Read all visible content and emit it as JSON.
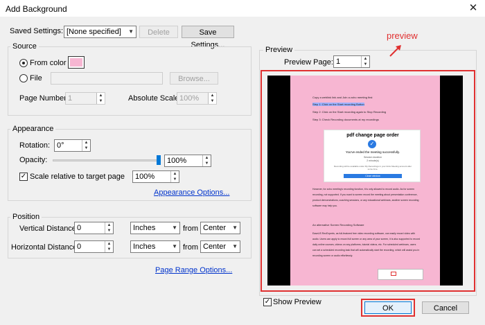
{
  "window": {
    "title": "Add Background",
    "close_icon": "close-icon"
  },
  "saved_settings": {
    "label": "Saved Settings:",
    "value": "[None specified]",
    "delete_label": "Delete",
    "save_label": "Save Settings..."
  },
  "source": {
    "heading": "Source",
    "from_color_label": "From color",
    "color_swatch": "#f7b6d2",
    "file_label": "File",
    "browse_label": "Browse...",
    "page_number_label": "Page Number:",
    "page_number_value": "1",
    "absolute_scale_label": "Absolute Scale:",
    "absolute_scale_value": "100%"
  },
  "appearance": {
    "heading": "Appearance",
    "rotation_label": "Rotation:",
    "rotation_value": "0°",
    "opacity_label": "Opacity:",
    "opacity_value": "100%",
    "opacity_level": 1.0,
    "scale_label": "Scale relative to target page",
    "scale_value": "100%",
    "options_link": "Appearance Options..."
  },
  "position": {
    "heading": "Position",
    "vertical_label": "Vertical Distance:",
    "vertical_value": "0",
    "vertical_unit": "Inches",
    "vertical_from_label": "from",
    "vertical_from": "Center",
    "horizontal_label": "Horizontal Distance:",
    "horizontal_value": "0",
    "horizontal_unit": "Inches",
    "horizontal_from_label": "from",
    "horizontal_from": "Center"
  },
  "page_range_link": "Page Range Options...",
  "preview": {
    "heading": "Preview",
    "annotation": "preview",
    "page_label": "Preview Page:",
    "page_value": "1",
    "show_preview_label": "Show Preview",
    "page_color": "#f7b6d2",
    "doc": {
      "line1": "Copy a weblink link and Join a zoho meeting first",
      "step1": "Step 1: Click on the Start recording Button",
      "step2": "Step 2: Click on the Start recording again to Stop Recording",
      "step3": "Step 3: Check Recording documents at my recordings",
      "card_title": "pdf change page order",
      "card_msg": "You've ended the meeting successfully.",
      "card_sub1": "Session duration",
      "card_sub2": "2 minute(s)",
      "card_note": "Recording will be available under My Recordings in your Zoho Meeting account after some time.",
      "card_button": "Close window",
      "para1": "However, for zoho meeting's recording function, it is only allowed to record audio. As for screen recording, not supported. If you want to screen record the meeting about presentation conference, product demonstrations, coaching sessions, or any educational webinars, another screen recording software may help you.",
      "heading2": "An alternative Screen Recording Software",
      "para2": "EaseUS RecExperts, as full-featured free video recording software, can easily record video with audio. Users can apply to record full screen or any area of your screen, it is also supported to record daily online courses, videos on any platforms, tutorial videos, etc. For scheduled webinars, users can set a scheduled recording task that will automatically start the recording, which will assist you in recording screen or audio effortlessly."
    }
  },
  "ok_label": "OK",
  "cancel_label": "Cancel"
}
